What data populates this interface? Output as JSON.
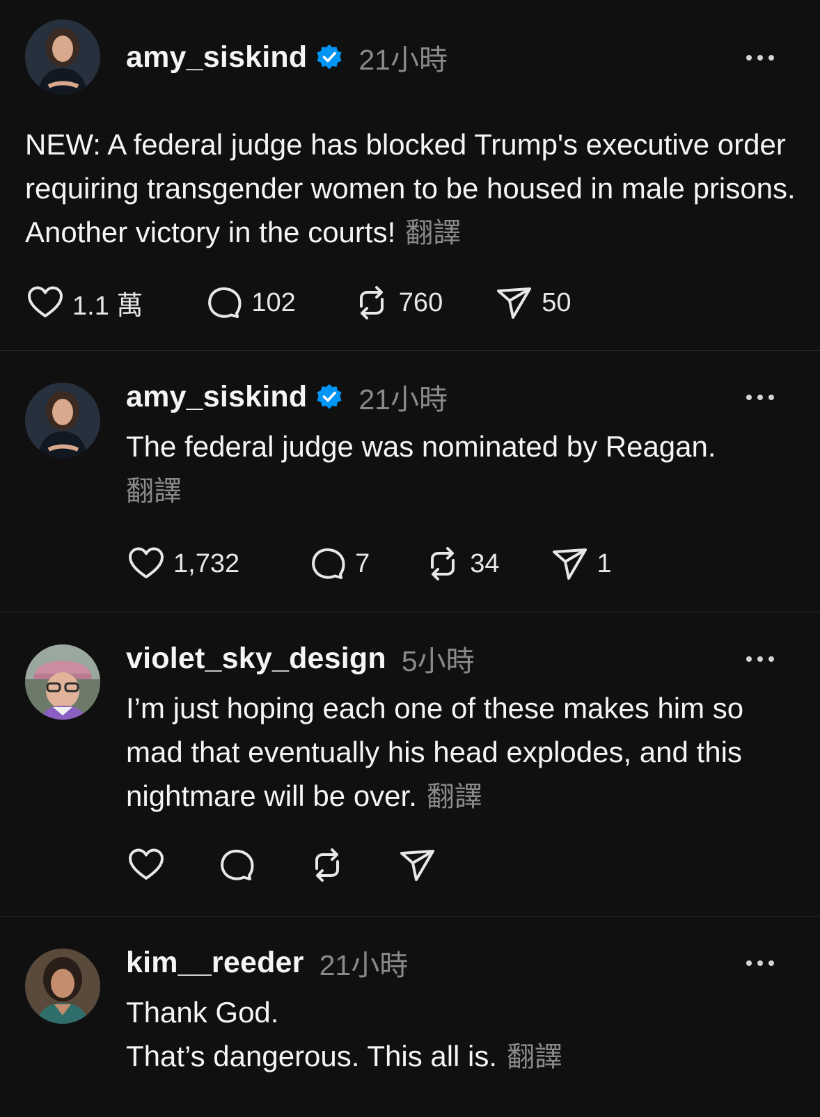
{
  "colors": {
    "background": "#101010",
    "text": "#f3f5f7",
    "muted": "#8a8a8a",
    "verified": "#0095f6",
    "divider": "#2a2a2a"
  },
  "posts": [
    {
      "username": "amy_siskind",
      "verified": true,
      "time": "21小時",
      "text": "NEW: A federal judge has blocked Trump's executive order requiring transgender women to be housed in male prisons. Another victory in the courts!",
      "translate": "翻譯",
      "likes": "1.1 萬",
      "replies": "102",
      "reposts": "760",
      "shares": "50"
    },
    {
      "username": "amy_siskind",
      "verified": true,
      "time": "21小時",
      "text": "The federal judge was nominated by Reagan.",
      "translate": "翻譯",
      "likes": "1,732",
      "replies": "7",
      "reposts": "34",
      "shares": "1"
    },
    {
      "username": "violet_sky_design",
      "verified": false,
      "time": "5小時",
      "text": "I’m just hoping each one of these makes him so mad that eventually his head explodes, and this nightmare will be over.",
      "translate": "翻譯",
      "likes": "",
      "replies": "",
      "reposts": "",
      "shares": ""
    },
    {
      "username": "kim__reeder",
      "verified": false,
      "time": "21小時",
      "text_line1": "Thank God.",
      "text_line2": "That’s dangerous. This all is.",
      "translate": "翻譯"
    }
  ],
  "icons": [
    "more-icon",
    "verified-badge-icon",
    "heart-icon",
    "comment-icon",
    "repost-icon",
    "share-icon"
  ]
}
